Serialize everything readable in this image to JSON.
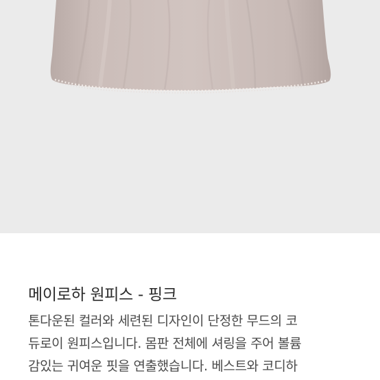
{
  "product": {
    "title": "메이로하 원피스 - 핑크",
    "description_lines": [
      "톤다운된 컬러와 세련된 디자인이 단정한 무드의 코",
      "듀로이 원피스입니다. 몸판 전체에 셔링을 주어 볼륨",
      "감있는 귀여운 핏을 연출했습니다. 베스트와 코디하"
    ]
  },
  "colors": {
    "photo_background": "#ebebeb",
    "dress_fabric": "#cbbdb9",
    "dress_shadow": "#b8aaa6",
    "lace_trim": "#f3ece8"
  }
}
